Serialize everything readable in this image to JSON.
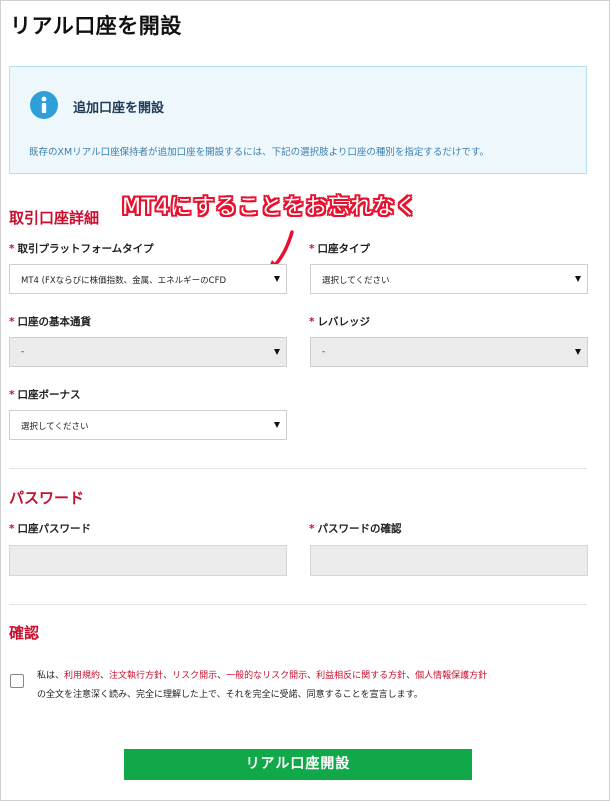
{
  "page": {
    "title": "リアル口座を開設"
  },
  "info": {
    "icon": "info-icon",
    "title": "追加口座を開設",
    "text": "既存のXMリアル口座保持者が追加口座を開設するには、下記の選択肢より口座の種別を指定するだけです。"
  },
  "annotation": {
    "text": "MT4にすることをお忘れなく",
    "arrow_icon": "arrow-icon",
    "color": "#e8102e"
  },
  "required_mark": "*",
  "account_details": {
    "title": "取引口座詳細",
    "platform": {
      "label": "取引プラットフォームタイプ",
      "value": "MT4 (FXならびに株価指数、金属、エネルギーのCFD"
    },
    "account_type": {
      "label": "口座タイプ",
      "value": "選択してください"
    },
    "base_currency": {
      "label": "口座の基本通貨",
      "value": "-"
    },
    "leverage": {
      "label": "レバレッジ",
      "value": "-"
    },
    "bonus": {
      "label": "口座ボーナス",
      "value": "選択してください"
    }
  },
  "password": {
    "title": "パスワード",
    "account_password": {
      "label": "口座パスワード",
      "value": ""
    },
    "confirm_password": {
      "label": "パスワードの確認",
      "value": ""
    }
  },
  "confirm": {
    "title": "確認",
    "prefix": "私は、",
    "links": [
      "利用規約",
      "注文執行方針",
      "リスク開示",
      "一般的なリスク開示",
      "利益相反に関する方針",
      "個人情報保護方針"
    ],
    "sep": "、",
    "suffix": "の全文を注意深く読み、完全に理解した上で、それを完全に受諾、同意することを宣言します。",
    "checked": false
  },
  "submit": {
    "label": "リアル口座開設",
    "color": "#11a84a"
  },
  "colors": {
    "accent_red": "#c8102e",
    "info_blue": "#2f9fd8"
  }
}
